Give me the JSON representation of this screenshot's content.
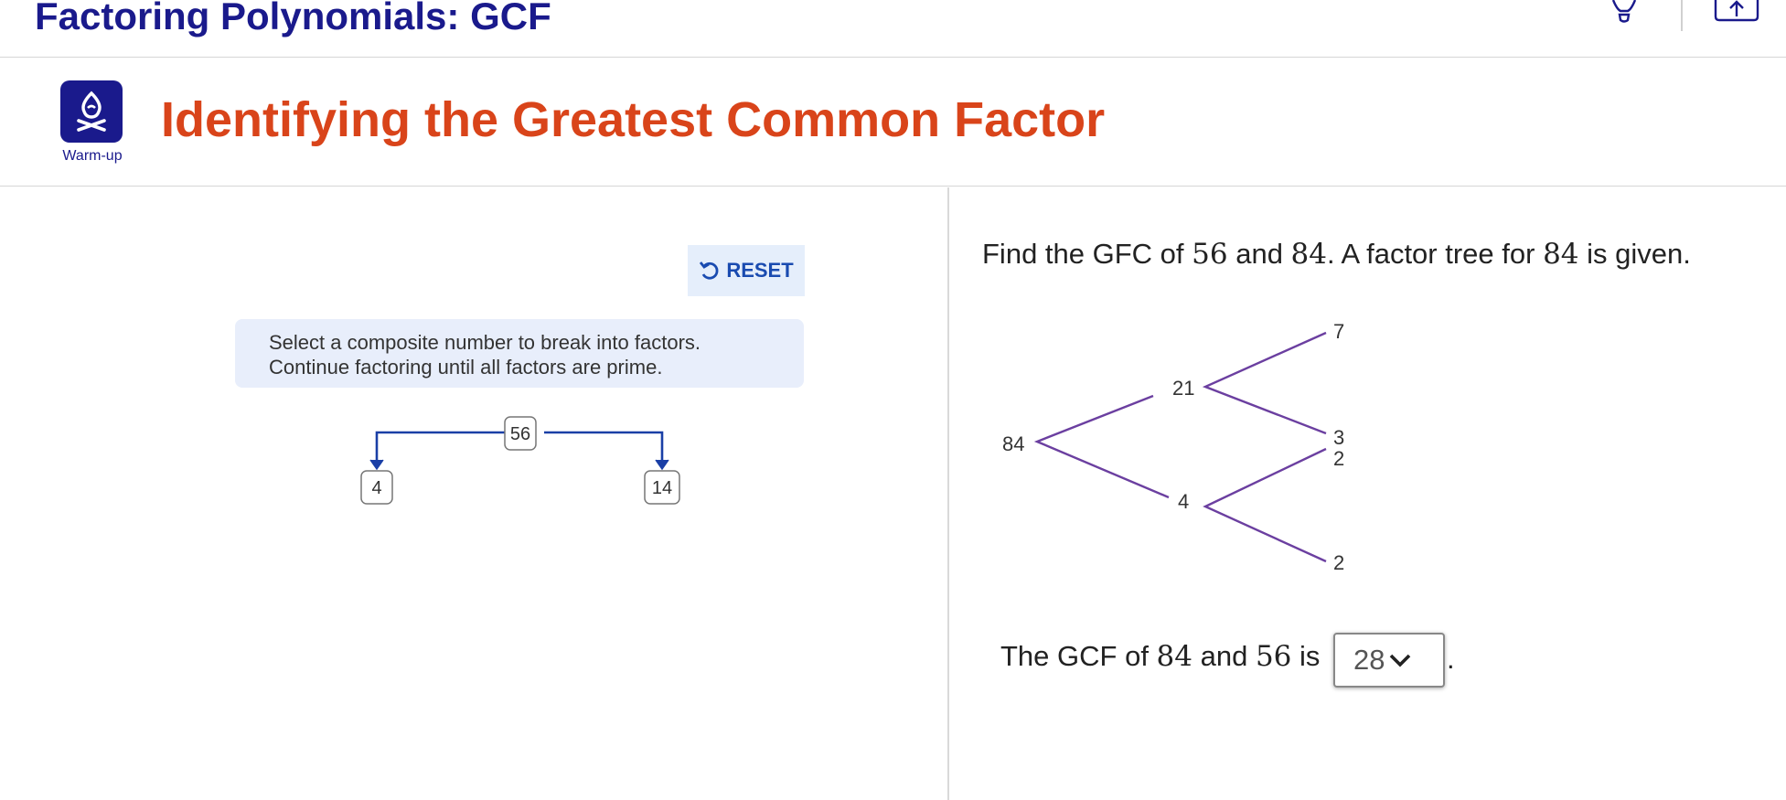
{
  "header": {
    "course_title": "Factoring Polynomials: GCF",
    "icons": [
      "lightbulb-icon",
      "export-icon"
    ]
  },
  "section": {
    "badge_icon": "campfire-icon",
    "badge_label": "Warm-up",
    "title": "Identifying the Greatest Common Factor"
  },
  "left_panel": {
    "reset_label": "RESET",
    "reset_icon": "undo-icon",
    "instructions": [
      "Select a composite number to break into factors.",
      "Continue factoring until all factors are prime."
    ],
    "tree": {
      "root": "56",
      "left": "4",
      "right": "14"
    },
    "colors": {
      "tree_line": "#1a3fa6"
    }
  },
  "right_panel": {
    "question": {
      "part1": "Find the GFC of ",
      "num1": "56",
      "part2": " and ",
      "num2": "84",
      "part3": ". A factor tree for ",
      "num3": "84",
      "part4": " is given."
    },
    "tree": {
      "root": "84",
      "level1_top": "21",
      "level1_bottom": "4",
      "leaves": [
        "7",
        "3",
        "2",
        "2"
      ]
    },
    "answer": {
      "part1": "The GCF of ",
      "num1": "84",
      "part2": " and ",
      "num2": "56",
      "part3": " is",
      "selected": "28",
      "period": "."
    },
    "colors": {
      "tree_line": "#6b3fa0"
    }
  },
  "colors": {
    "course_title": "#1a1a8c",
    "section_title": "#d9441a",
    "badge_bg": "#1a1a8c",
    "reset_text": "#1a4bb0",
    "reset_bg": "#e5eefb"
  }
}
